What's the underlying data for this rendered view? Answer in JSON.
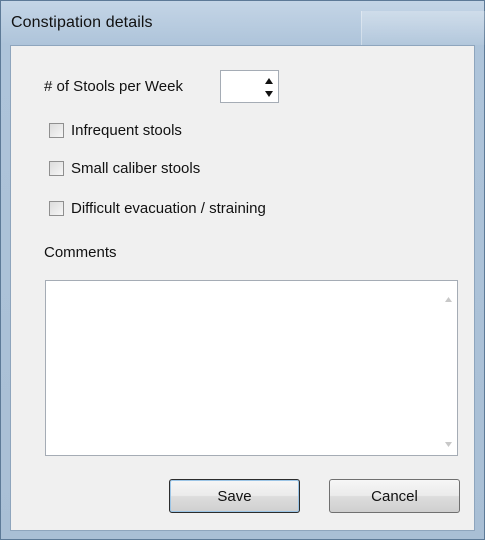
{
  "window": {
    "title": "Constipation details"
  },
  "form": {
    "stools_label": "# of Stools per Week",
    "stools_value": "",
    "checkboxes": [
      {
        "label": "Infrequent stools",
        "checked": false
      },
      {
        "label": "Small caliber stools",
        "checked": false
      },
      {
        "label": "Difficult evacuation / straining",
        "checked": false
      }
    ],
    "comments_label": "Comments",
    "comments_value": ""
  },
  "buttons": {
    "save_label": "Save",
    "cancel_label": "Cancel"
  },
  "icons": {
    "spin_up": "triangle-up-icon",
    "spin_down": "triangle-down-icon",
    "scroll_up": "scroll-up-arrow-icon",
    "scroll_down": "scroll-down-arrow-icon"
  },
  "colors": {
    "frame": "#aec4da",
    "client": "#f0f0f0"
  }
}
